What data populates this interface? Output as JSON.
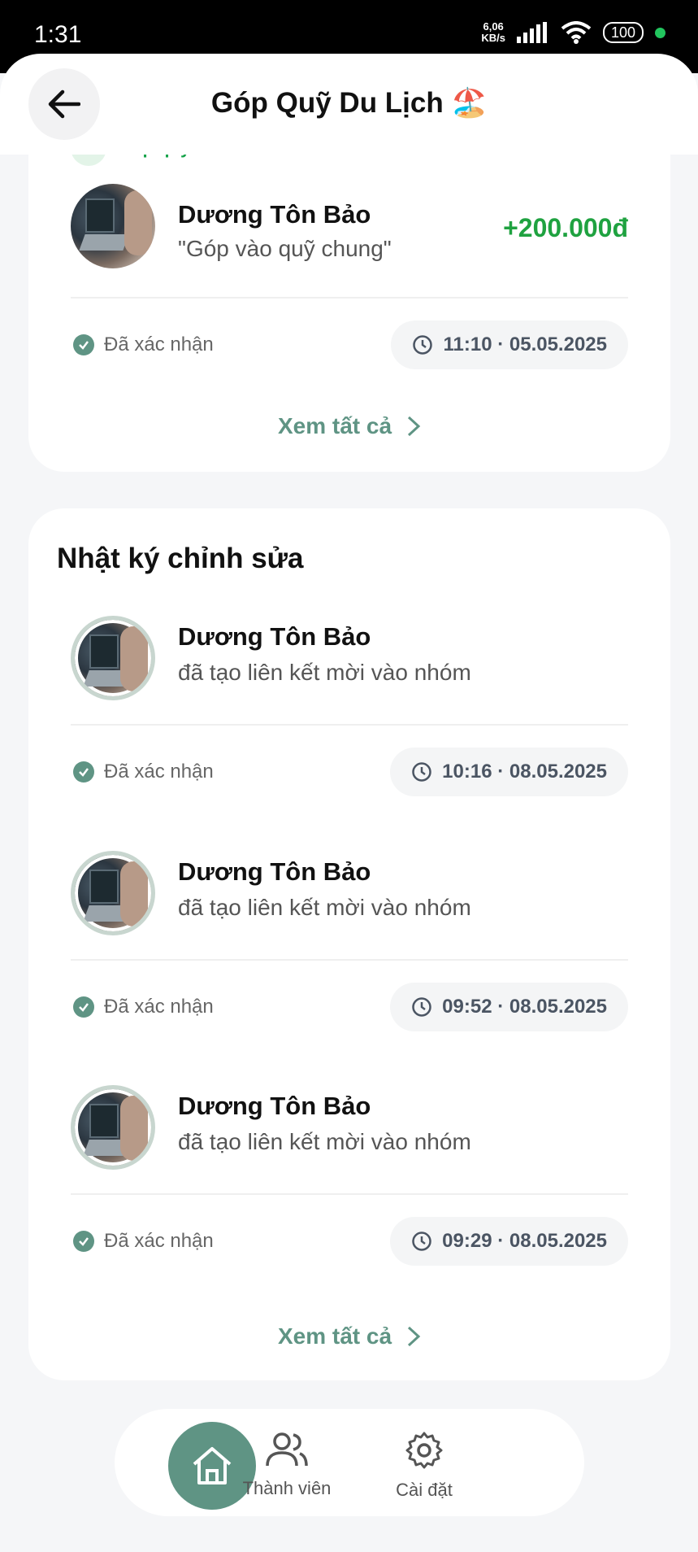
{
  "status_bar": {
    "time": "1:31",
    "speed_value": "6,06",
    "speed_unit": "KB/s",
    "battery": "100"
  },
  "header": {
    "title": "Góp Quỹ Du Lịch 🏖️"
  },
  "contributions": {
    "partial_label": "Góp quỹ",
    "entry": {
      "name": "Dương Tôn Bảo",
      "note": "\"Góp vào quỹ chung\"",
      "amount": "+200.000đ",
      "status": "Đã xác nhận",
      "time": "11:10 · 05.05.2025"
    },
    "see_all": "Xem tất cả"
  },
  "edit_log": {
    "title": "Nhật ký chỉnh sửa",
    "entries": [
      {
        "name": "Dương Tôn Bảo",
        "action": "đã tạo liên kết mời vào nhóm",
        "status": "Đã xác nhận",
        "time": "10:16 · 08.05.2025"
      },
      {
        "name": "Dương Tôn Bảo",
        "action": "đã tạo liên kết mời vào nhóm",
        "status": "Đã xác nhận",
        "time": "09:52 · 08.05.2025"
      },
      {
        "name": "Dương Tôn Bảo",
        "action": "đã tạo liên kết mời vào nhóm",
        "status": "Đã xác nhận",
        "time": "09:29 · 08.05.2025"
      }
    ],
    "see_all": "Xem tất cả"
  },
  "bottom_nav": {
    "home_icon": "home-icon",
    "members_label": "Thành viên",
    "settings_label": "Cài đặt"
  },
  "colors": {
    "accent": "#5f9484",
    "amount": "#1fa240"
  }
}
